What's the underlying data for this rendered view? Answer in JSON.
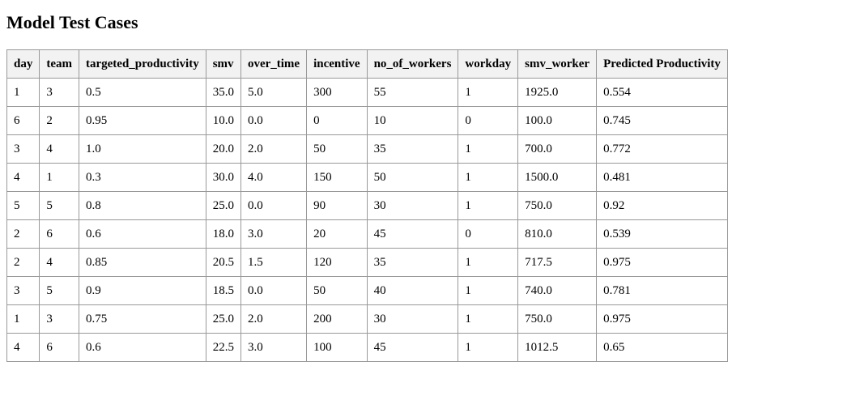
{
  "page": {
    "title": "Model Test Cases"
  },
  "table": {
    "headers": [
      "day",
      "team",
      "targeted_productivity",
      "smv",
      "over_time",
      "incentive",
      "no_of_workers",
      "workday",
      "smv_worker",
      "Predicted Productivity"
    ],
    "rows": [
      [
        "1",
        "3",
        "0.5",
        "35.0",
        "5.0",
        "300",
        "55",
        "1",
        "1925.0",
        "0.554"
      ],
      [
        "6",
        "2",
        "0.95",
        "10.0",
        "0.0",
        "0",
        "10",
        "0",
        "100.0",
        "0.745"
      ],
      [
        "3",
        "4",
        "1.0",
        "20.0",
        "2.0",
        "50",
        "35",
        "1",
        "700.0",
        "0.772"
      ],
      [
        "4",
        "1",
        "0.3",
        "30.0",
        "4.0",
        "150",
        "50",
        "1",
        "1500.0",
        "0.481"
      ],
      [
        "5",
        "5",
        "0.8",
        "25.0",
        "0.0",
        "90",
        "30",
        "1",
        "750.0",
        "0.92"
      ],
      [
        "2",
        "6",
        "0.6",
        "18.0",
        "3.0",
        "20",
        "45",
        "0",
        "810.0",
        "0.539"
      ],
      [
        "2",
        "4",
        "0.85",
        "20.5",
        "1.5",
        "120",
        "35",
        "1",
        "717.5",
        "0.975"
      ],
      [
        "3",
        "5",
        "0.9",
        "18.5",
        "0.0",
        "50",
        "40",
        "1",
        "740.0",
        "0.781"
      ],
      [
        "1",
        "3",
        "0.75",
        "25.0",
        "2.0",
        "200",
        "30",
        "1",
        "750.0",
        "0.975"
      ],
      [
        "4",
        "6",
        "0.6",
        "22.5",
        "3.0",
        "100",
        "45",
        "1",
        "1012.5",
        "0.65"
      ]
    ]
  }
}
